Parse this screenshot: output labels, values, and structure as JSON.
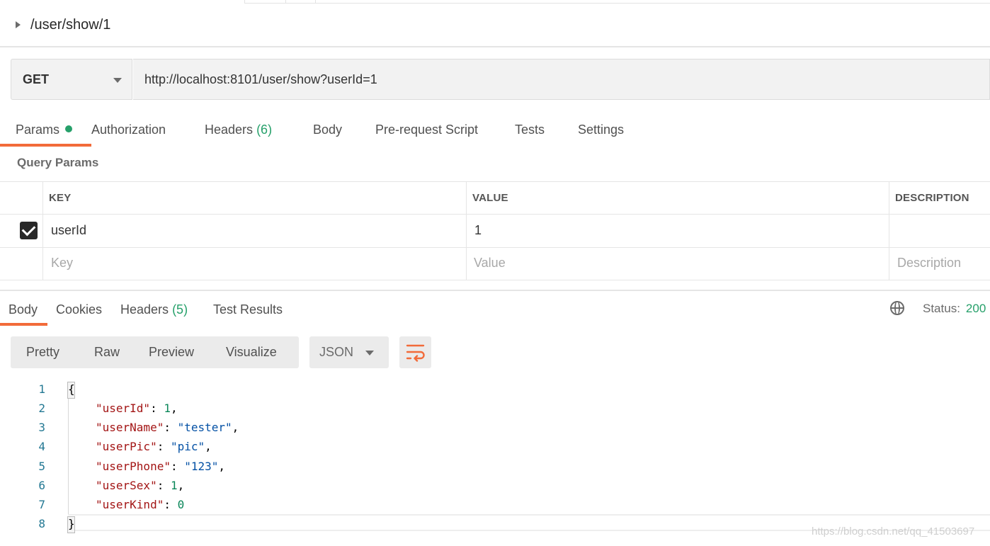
{
  "breadcrumb": {
    "path": "/user/show/1"
  },
  "request": {
    "method": "GET",
    "url": "http://localhost:8101/user/show?userId=1"
  },
  "request_tabs": [
    {
      "label": "Params",
      "badge": ""
    },
    {
      "label": "Authorization",
      "badge": ""
    },
    {
      "label": "Headers",
      "badge": "(6)"
    },
    {
      "label": "Body",
      "badge": ""
    },
    {
      "label": "Pre-request Script",
      "badge": ""
    },
    {
      "label": "Tests",
      "badge": ""
    },
    {
      "label": "Settings",
      "badge": ""
    }
  ],
  "query_params": {
    "title": "Query Params",
    "headers": {
      "key": "KEY",
      "value": "VALUE",
      "description": "DESCRIPTION"
    },
    "rows": [
      {
        "key": "userId",
        "value": "1",
        "description": "",
        "checked": true
      }
    ],
    "placeholders": {
      "key": "Key",
      "value": "Value",
      "description": "Description"
    }
  },
  "response_tabs": [
    {
      "label": "Body",
      "badge": ""
    },
    {
      "label": "Cookies",
      "badge": ""
    },
    {
      "label": "Headers",
      "badge": "(5)"
    },
    {
      "label": "Test Results",
      "badge": ""
    }
  ],
  "status": {
    "label": "Status:",
    "value": "200"
  },
  "view_modes": [
    "Pretty",
    "Raw",
    "Preview",
    "Visualize"
  ],
  "format": "JSON",
  "code_lines": [
    {
      "n": "1"
    },
    {
      "n": "2"
    },
    {
      "n": "3"
    },
    {
      "n": "4"
    },
    {
      "n": "5"
    },
    {
      "n": "6"
    },
    {
      "n": "7"
    },
    {
      "n": "8"
    }
  ],
  "json_body": {
    "open": "{",
    "close": "}",
    "fields": [
      {
        "key": "\"userId\"",
        "value": "1",
        "type": "num",
        "comma": ","
      },
      {
        "key": "\"userName\"",
        "value": "\"tester\"",
        "type": "str",
        "comma": ","
      },
      {
        "key": "\"userPic\"",
        "value": "\"pic\"",
        "type": "str",
        "comma": ","
      },
      {
        "key": "\"userPhone\"",
        "value": "\"123\"",
        "type": "str",
        "comma": ","
      },
      {
        "key": "\"userSex\"",
        "value": "1",
        "type": "num",
        "comma": ","
      },
      {
        "key": "\"userKind\"",
        "value": "0",
        "type": "num",
        "comma": ""
      }
    ]
  },
  "watermark": "https://blog.csdn.net/qq_41503697",
  "colors": {
    "accent": "#f26b3a",
    "success": "#26a06a"
  }
}
